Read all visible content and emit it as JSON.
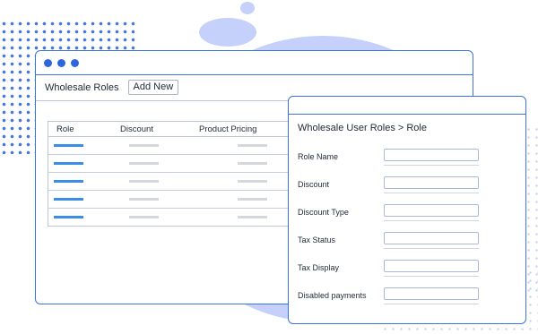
{
  "main": {
    "page_title": "Wholesale Roles",
    "add_new_label": "Add New",
    "table": {
      "headers": [
        "Role",
        "Discount",
        "Product Pricing"
      ],
      "row_count": 5
    }
  },
  "edit": {
    "title": "Wholesale User Roles > Role",
    "fields": [
      {
        "label": "Role Name",
        "value": ""
      },
      {
        "label": "Discount",
        "value": ""
      },
      {
        "label": "Discount Type",
        "value": ""
      },
      {
        "label": "Tax Status",
        "value": ""
      },
      {
        "label": "Tax Display",
        "value": ""
      },
      {
        "label": "Disabled payments",
        "value": ""
      }
    ]
  },
  "colors": {
    "accent": "#3b73e0",
    "blob": "#c5d1fb",
    "placeholder_blue": "#3b8ee8",
    "placeholder_gray": "#d4d7dc"
  }
}
